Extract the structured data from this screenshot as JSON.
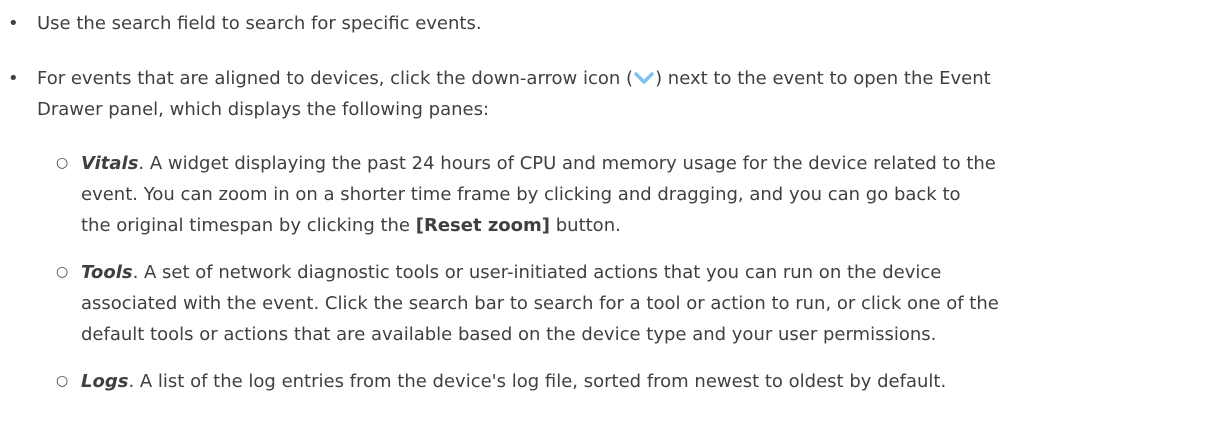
{
  "bullets": [
    {
      "text": "Use the search field to search for specific events."
    },
    {
      "text_before_icon": "For events that are aligned to devices, click the down-arrow icon (",
      "text_after_icon": ") next to the event to open the Event",
      "text_line2": "Drawer panel, which displays the following panes:"
    }
  ],
  "panes": [
    {
      "term": "Vitals",
      "line1": ". A widget displaying the past 24 hours of CPU and memory usage for the device related to the",
      "line2": "event. You can zoom in on a shorter time frame by clicking and dragging, and you can go back to",
      "line3_before": "the original timespan by clicking the ",
      "line3_button": "[Reset zoom]",
      "line3_after": " button."
    },
    {
      "term": "Tools",
      "line1": ". A set of network diagnostic tools or user-initiated actions that you can run on the device",
      "line2": "associated with the event. Click the search bar to search for a tool or action to run, or click one of the",
      "line3": "default tools or actions that are available based on the device type and your user permissions."
    },
    {
      "term": "Logs",
      "line1": ". A list of the log entries from the device's log file, sorted from newest to oldest by default."
    }
  ],
  "icon": {
    "name": "chevron-down-icon",
    "color": "#7ec3ef"
  }
}
